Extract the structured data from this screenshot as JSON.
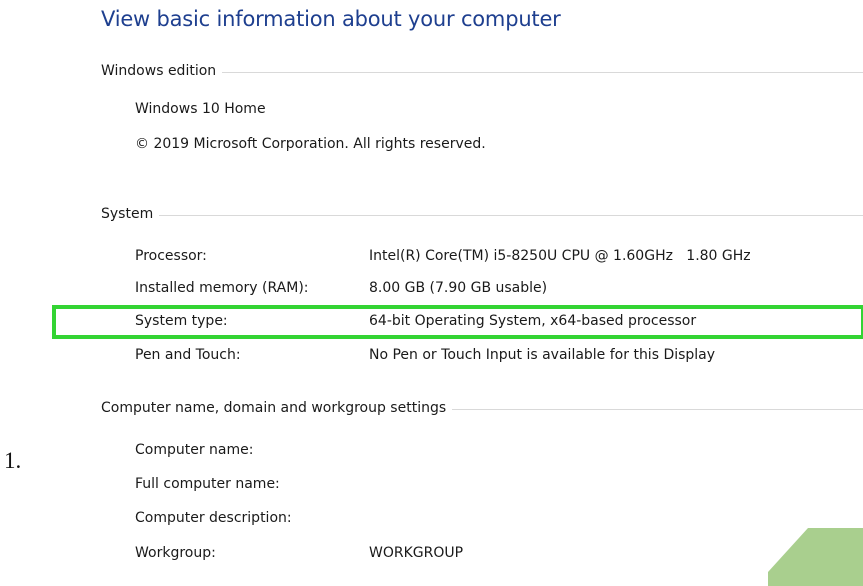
{
  "page_title": "View basic information about your computer",
  "windows_edition": {
    "header": "Windows edition",
    "edition": "Windows 10 Home",
    "copyright": "© 2019 Microsoft Corporation. All rights reserved."
  },
  "system": {
    "header": "System",
    "rows": [
      {
        "label": "Processor:",
        "value": "Intel(R) Core(TM) i5-8250U CPU @ 1.60GHz   1.80 GHz"
      },
      {
        "label": "Installed memory (RAM):",
        "value": "8.00 GB (7.90 GB usable)"
      },
      {
        "label": "System type:",
        "value": "64-bit Operating System, x64-based processor"
      },
      {
        "label": "Pen and Touch:",
        "value": "No Pen or Touch Input is available for this Display"
      }
    ]
  },
  "computer_name_section": {
    "header": "Computer name, domain and workgroup settings",
    "rows": [
      {
        "label": "Computer name:",
        "value": ""
      },
      {
        "label": "Full computer name:",
        "value": ""
      },
      {
        "label": "Computer description:",
        "value": ""
      },
      {
        "label": "Workgroup:",
        "value": "WORKGROUP"
      }
    ]
  },
  "step_number": "1.",
  "colors": {
    "title": "#1e3f8f",
    "highlight": "#33d433",
    "corner_shape": "#a9cf8e"
  }
}
